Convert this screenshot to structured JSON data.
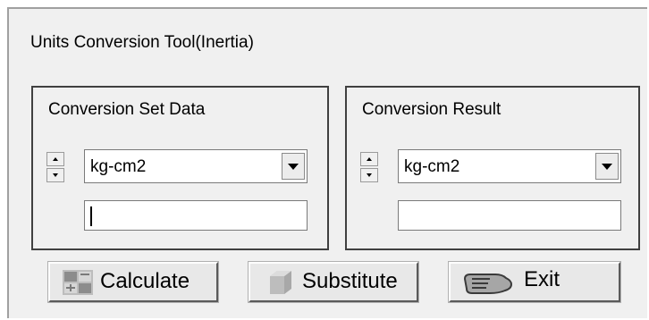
{
  "window": {
    "title": "Units Conversion Tool(Inertia)"
  },
  "set_data": {
    "title": "Conversion Set Data",
    "unit_selected": "kg-cm2",
    "value": ""
  },
  "result": {
    "title": "Conversion Result",
    "unit_selected": "kg-cm2",
    "value": ""
  },
  "buttons": {
    "calculate": "Calculate",
    "substitute": "Substitute",
    "exit": "Exit"
  },
  "icons": {
    "calculate": "calculator-icon",
    "substitute": "substitute-icon",
    "exit": "hand-pointing-icon"
  }
}
